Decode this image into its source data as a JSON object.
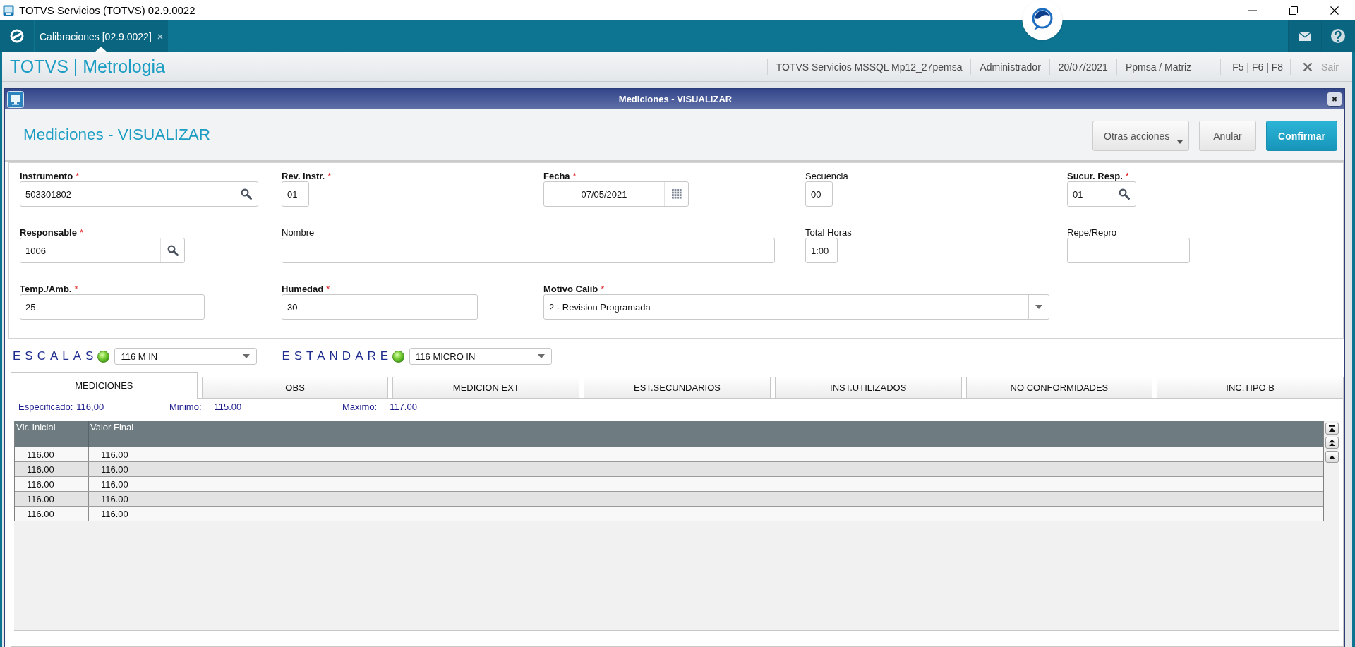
{
  "window": {
    "title": "TOTVS Servicios (TOTVS) 02.9.0022"
  },
  "app_bar": {
    "tabs": [
      {
        "label": "Calibraciones [02.9.0022]",
        "selected": true
      }
    ]
  },
  "header": {
    "title": "TOTVS | Metrologia",
    "info": [
      "TOTVS Servicios MSSQL Mp12_27pemsa",
      "Administrador",
      "20/07/2021",
      "Ppmsa / Matriz"
    ],
    "shortcuts": "F5 | F6 | F8",
    "exit_label": "Sair"
  },
  "dialog": {
    "title": "Mediciones - VISUALIZAR",
    "heading": "Mediciones - VISUALIZAR",
    "actions": [
      {
        "label": "Otras acciones",
        "kind": "menu"
      },
      {
        "label": "Anular",
        "kind": "cancel"
      },
      {
        "label": "Confirmar",
        "kind": "confirm"
      }
    ]
  },
  "form": {
    "rows": [
      [
        {
          "label": "Instrumento",
          "required_mark": "*",
          "kind": "lookup",
          "value": "503301802"
        },
        {
          "label": "Rev. Instr.",
          "required_mark": "*",
          "kind": "text",
          "value": "01"
        },
        {
          "label": "Fecha",
          "required_mark": "*",
          "kind": "date",
          "value": "07/05/2021"
        },
        {
          "label": "Secuencia",
          "kind": "text",
          "value": "00"
        },
        {
          "label": "Sucur. Resp.",
          "required_mark": "*",
          "kind": "lookup",
          "value": "01"
        }
      ],
      [
        {
          "label": "Responsable",
          "required_mark": "*",
          "kind": "lookup",
          "value": "1006"
        },
        {
          "label": "Nombre",
          "kind": "text"
        },
        "",
        {
          "label": "Total Horas",
          "kind": "text",
          "value": "1:00"
        },
        {
          "label": "Repe/Repro",
          "kind": "text"
        }
      ],
      [
        {
          "label": "Temp./Amb.",
          "required_mark": "*",
          "kind": "text",
          "value": "25"
        },
        {
          "label": "Humedad",
          "required_mark": "*",
          "kind": "text",
          "value": "30"
        },
        {
          "label": "Motivo Calib",
          "required_mark": "*",
          "kind": "select",
          "value": "2 - Revision Programada"
        },
        ""
      ]
    ]
  },
  "selectors": [
    {
      "label": "ESCALAS",
      "value": "116 M IN"
    },
    {
      "label": "ESTANDARE",
      "value": "116 MICRO IN"
    }
  ],
  "tabs": [
    {
      "label": "MEDICIONES",
      "selected": true
    },
    {
      "label": "OBS",
      "selected": false
    },
    {
      "label": "MEDICION EXT",
      "selected": false
    },
    {
      "label": "EST.SECUNDARIOS",
      "selected": false
    },
    {
      "label": "INST.UTILIZADOS",
      "selected": false
    },
    {
      "label": "NO CONFORMIDADES",
      "selected": false
    },
    {
      "label": "INC.TIPO B",
      "selected": false
    }
  ],
  "limits": [
    {
      "label": "Especificado:",
      "value": "116,00"
    },
    {
      "label": "Minimo:",
      "value": "115.00"
    },
    {
      "label": "Maximo:",
      "value": "117.00"
    }
  ],
  "table": {
    "columns": [
      "Vlr. Inicial",
      "Valor Final"
    ],
    "rows": [
      [
        "116.00",
        "116.00"
      ],
      [
        "116.00",
        "116.00"
      ],
      [
        "116.00",
        "116.00"
      ],
      [
        "116.00",
        "116.00"
      ],
      [
        "116.00",
        "116.00"
      ]
    ]
  }
}
